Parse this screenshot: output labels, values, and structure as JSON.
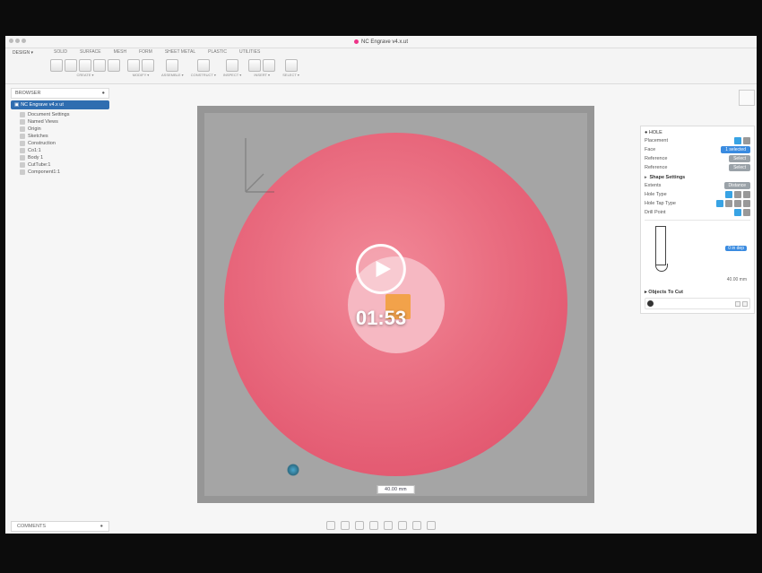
{
  "video": {
    "timestamp": "01:53"
  },
  "titlebar": {
    "document": "NC Engrave v4.x.ut"
  },
  "workspace_label": "DESIGN ▾",
  "ribbon": {
    "tabs": [
      "SOLID",
      "SURFACE",
      "MESH",
      "FORM",
      "SHEET METAL",
      "PLASTIC",
      "UTILITIES"
    ],
    "active_tab": "SOLID",
    "groups": [
      {
        "label": "CREATE ▾",
        "icons": 5
      },
      {
        "label": "MODIFY ▾",
        "icons": 2
      },
      {
        "label": "ASSEMBLE ▾",
        "icons": 1
      },
      {
        "label": "CONSTRUCT ▾",
        "icons": 1
      },
      {
        "label": "INSPECT ▾",
        "icons": 1
      },
      {
        "label": "INSERT ▾",
        "icons": 2
      },
      {
        "label": "SELECT ▾",
        "icons": 1
      }
    ]
  },
  "browser": {
    "header": "BROWSER",
    "root": "NC Engrave v4.x ut",
    "items": [
      "Document Settings",
      "Named Views",
      "Origin",
      "Sketches",
      "Construction",
      "Co1:1",
      "Body 1",
      "CutTube:1",
      "Component1:1"
    ]
  },
  "props": {
    "title": "HOLE",
    "rows": {
      "placement_label": "Placement",
      "placement_value": "⌖",
      "face_label": "Face",
      "face_value": "1 selected",
      "reference_label": "Reference",
      "ref_toggle_label": "Reference",
      "ref_toggle_value": "Select"
    },
    "shape_section": "Shape Settings",
    "shape_rows": {
      "extents_label": "Extents",
      "extents_value": "Distance",
      "hole_type_label": "Hole Type",
      "tap_label": "Hole Tap Type",
      "drill_label": "Drill Point"
    },
    "diagram": {
      "depth_value": "0 in dep",
      "diam_value": "40.00 mm"
    },
    "objects_section": "Objects To Cut"
  },
  "viewport": {
    "readout": "40.00 mm"
  },
  "comments_label": "COMMENTS"
}
